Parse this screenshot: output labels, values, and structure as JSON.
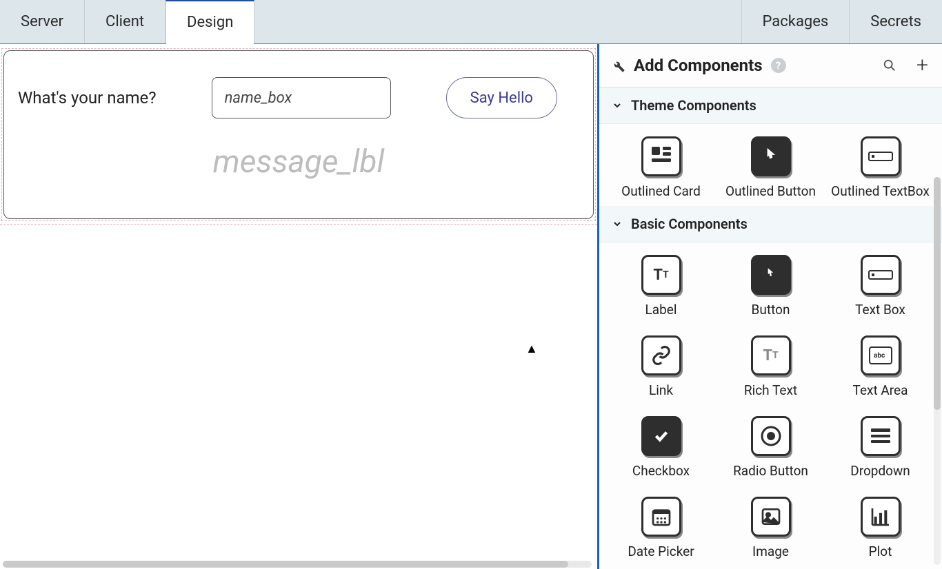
{
  "tabs": {
    "server": "Server",
    "client": "Client",
    "design": "Design",
    "packages": "Packages",
    "secrets": "Secrets"
  },
  "canvas": {
    "prompt": "What's your name?",
    "textbox_placeholder": "name_box",
    "button_label": "Say Hello",
    "message_placeholder": "message_lbl"
  },
  "sidebar": {
    "title": "Add Components",
    "sections": {
      "theme": {
        "title": "Theme Components",
        "items": [
          {
            "label": "Outlined Card"
          },
          {
            "label": "Outlined Button"
          },
          {
            "label": "Outlined TextBox"
          }
        ]
      },
      "basic": {
        "title": "Basic Components",
        "items": [
          {
            "label": "Label"
          },
          {
            "label": "Button"
          },
          {
            "label": "Text Box"
          },
          {
            "label": "Link"
          },
          {
            "label": "Rich Text"
          },
          {
            "label": "Text Area"
          },
          {
            "label": "Checkbox"
          },
          {
            "label": "Radio Button"
          },
          {
            "label": "Dropdown"
          },
          {
            "label": "Date Picker"
          },
          {
            "label": "Image"
          },
          {
            "label": "Plot"
          }
        ]
      }
    }
  }
}
